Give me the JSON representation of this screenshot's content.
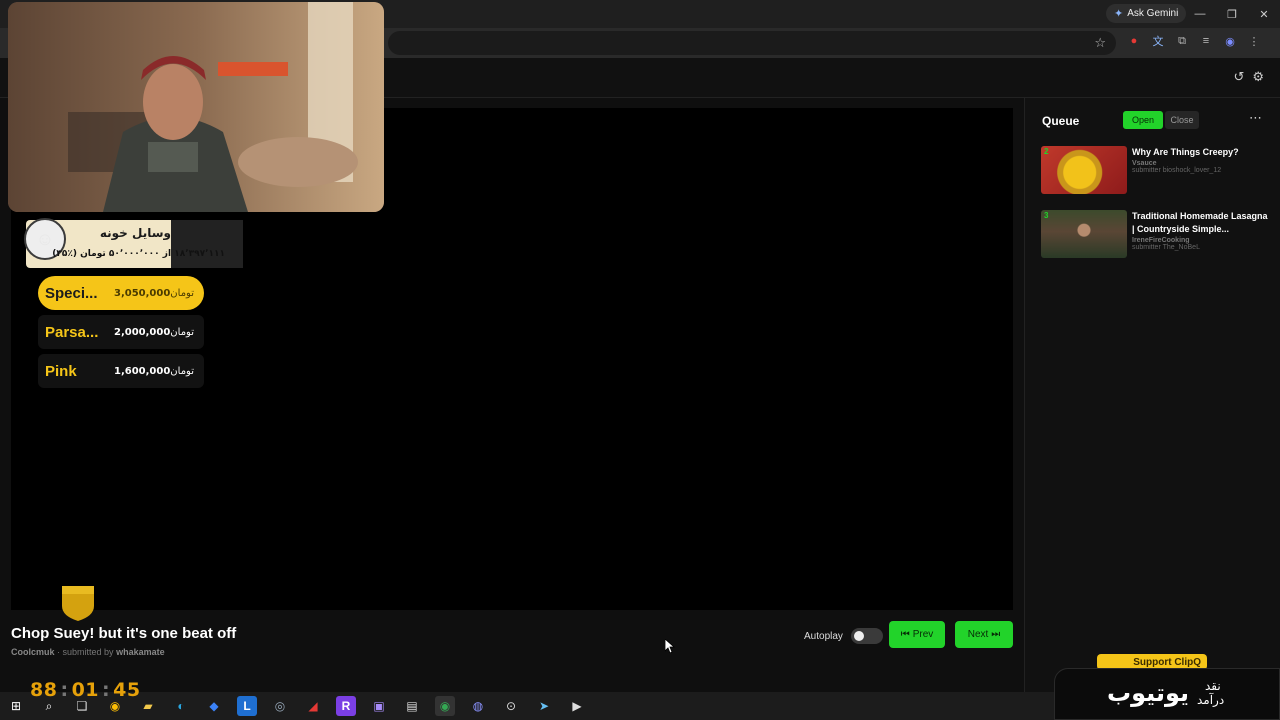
{
  "browser": {
    "ask_gemini": "Ask Gemini",
    "window_controls": [
      "—",
      "❐",
      "✕"
    ]
  },
  "player": {
    "title": "Chop Suey! but it's one beat off",
    "channel": "Coolcmuk",
    "submitted_by_label": "submitted by",
    "submitter": "whakamate",
    "autoplay_label": "Autoplay",
    "autoplay_on": false,
    "prev_label": "Prev",
    "next_label": "Next"
  },
  "queue": {
    "title": "Queue",
    "open_label": "Open",
    "close_label": "Close",
    "items": [
      {
        "num": "2",
        "title": "Why Are Things Creepy?",
        "channel": "Vsauce",
        "submitter": "submitter bioshock_lover_12"
      },
      {
        "num": "3",
        "title": "Traditional Homemade Lasagna | Countryside Simple...",
        "channel": "IreneFireCooking",
        "submitter": "submitter The_NoBeL"
      }
    ]
  },
  "overlay": {
    "donation_title": "وسایل خونه",
    "donation_progress": "۱۸٬۳۹۷٬۱۱۱ از ۵۰٬۰۰۰٬۰۰۰ تومان (٪۳۵)",
    "leaderboard": [
      {
        "name": "Speci...",
        "amount": "3,050,000",
        "currency": "تومان"
      },
      {
        "name": "Parsa...",
        "amount": "2,000,000",
        "currency": "تومان"
      },
      {
        "name": "Pink",
        "amount": "1,600,000",
        "currency": "تومان"
      }
    ],
    "clock": {
      "h": "88",
      "m": "01",
      "s": "45"
    },
    "support_label": "Support ClipQ",
    "yt_big": "یوتیوب",
    "yt_small_1": "نقد",
    "yt_small_2": "درآمد"
  },
  "colors": {
    "accent_green": "#22d32a",
    "gold": "#f5c518",
    "clock": "#e6a10a"
  }
}
